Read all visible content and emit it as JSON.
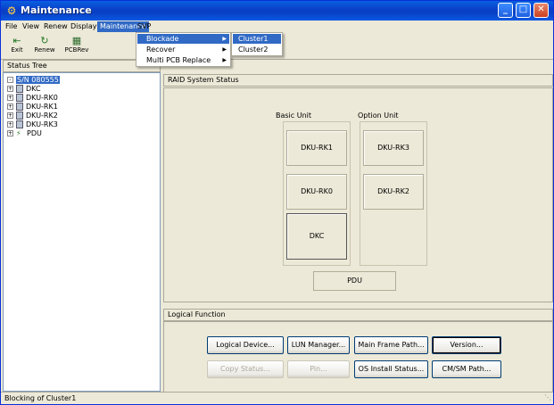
{
  "window": {
    "title": "Maintenance",
    "app_icon": "tool-icon"
  },
  "menubar": {
    "file": "File",
    "view": "View",
    "renew": "Renew",
    "display": "Display",
    "maintenance": "Maintenance",
    "svp": "SVP"
  },
  "toolbar": {
    "exit": "Exit",
    "renew": "Renew",
    "pcbrev": "PCBRev"
  },
  "maintenance_menu": {
    "blockade": "Blockade",
    "recover": "Recover",
    "multi_pcb": "Multi PCB Replace"
  },
  "blockade_submenu": {
    "cluster1": "Cluster1",
    "cluster2": "Cluster2"
  },
  "status_tree": {
    "header": "Status Tree",
    "root": "S/N 080555",
    "nodes": [
      "DKC",
      "DKU-RK0",
      "DKU-RK1",
      "DKU-RK2",
      "DKU-RK3",
      "PDU"
    ]
  },
  "raid": {
    "header": "RAID System Status",
    "basic_unit": "Basic Unit",
    "option_unit": "Option Unit",
    "rk1": "DKU-RK1",
    "rk3": "DKU-RK3",
    "rk0": "DKU-RK0",
    "rk2": "DKU-RK2",
    "dkc": "DKC",
    "pdu": "PDU"
  },
  "logical": {
    "header": "Logical Function",
    "logical_device": "Logical Device...",
    "lun_manager": "LUN Manager...",
    "main_frame_path": "Main Frame Path...",
    "version": "Version...",
    "copy_status": "Copy Status...",
    "pin": "Pin...",
    "os_install_status": "OS Install Status...",
    "cm_sm_path": "CM/SM Path..."
  },
  "statusbar": {
    "text": "Blocking of Cluster1"
  }
}
